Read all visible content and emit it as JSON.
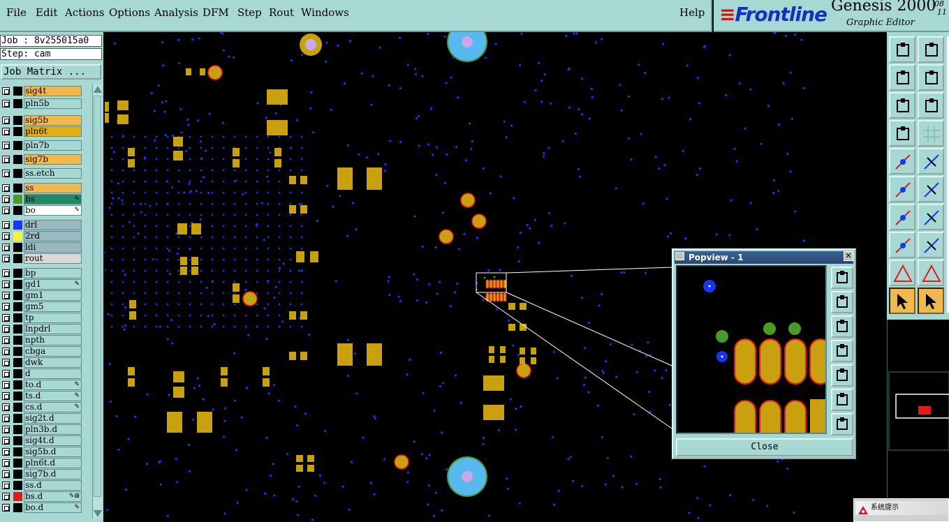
{
  "menubar": {
    "items": [
      "File",
      "Edit",
      "Actions",
      "Options",
      "Analysis",
      "DFM",
      "Step",
      "Rout",
      "Windows"
    ],
    "help": "Help"
  },
  "brand": {
    "logo": "Frontline",
    "product": "Genesis 2000",
    "subtitle": "Graphic Editor",
    "version_top": "08",
    "version_bottom": "11"
  },
  "job": {
    "job_line": "Job : 8v255015a0",
    "step_line": "Step: cam",
    "matrix_button": "Job Matrix ..."
  },
  "layers": [
    {
      "name": "sig4t",
      "bg": "#f0b850",
      "swatch": "#000000",
      "edit": ""
    },
    {
      "name": "pln5b",
      "bg": "#a8d8d4",
      "swatch": "#000000",
      "edit": ""
    },
    {
      "name": "sig5b",
      "bg": "#f0b850",
      "swatch": "#000000",
      "edit": ""
    },
    {
      "name": "pln6t",
      "bg": "#e0b018",
      "swatch": "#000000",
      "edit": ""
    },
    {
      "name": "pln7b",
      "bg": "#a8d8d4",
      "swatch": "#000000",
      "edit": ""
    },
    {
      "name": "sig7b",
      "bg": "#f0b850",
      "swatch": "#000000",
      "edit": ""
    },
    {
      "name": "ss.etch",
      "bg": "#a8d8d4",
      "swatch": "#000000",
      "edit": ""
    },
    {
      "name": "ss",
      "bg": "#f0b850",
      "swatch": "#000000",
      "edit": ""
    },
    {
      "name": "bs",
      "bg": "#1f8a60",
      "swatch": "#4a9a28",
      "edit": "✎"
    },
    {
      "name": "bo",
      "bg": "#ffffff",
      "swatch": "#000000",
      "edit": "✎"
    },
    {
      "name": "drl",
      "bg": "#9ab8c0",
      "swatch": "#1838f0",
      "edit": ""
    },
    {
      "name": "2rd",
      "bg": "#9ab8c0",
      "swatch": "#f8f040",
      "edit": ""
    },
    {
      "name": "ldi",
      "bg": "#9ab8c0",
      "swatch": "#000000",
      "edit": ""
    },
    {
      "name": "rout",
      "bg": "#d8d8d8",
      "swatch": "#000000",
      "edit": ""
    },
    {
      "name": "bp",
      "bg": "#a8d8d4",
      "swatch": "#000000",
      "edit": ""
    },
    {
      "name": "gd1",
      "bg": "#a8d8d4",
      "swatch": "#000000",
      "edit": "✎"
    },
    {
      "name": "gm1",
      "bg": "#a8d8d4",
      "swatch": "#000000",
      "edit": ""
    },
    {
      "name": "gm5",
      "bg": "#a8d8d4",
      "swatch": "#000000",
      "edit": ""
    },
    {
      "name": "tp",
      "bg": "#a8d8d4",
      "swatch": "#000000",
      "edit": ""
    },
    {
      "name": "lnpdrl",
      "bg": "#a8d8d4",
      "swatch": "#000000",
      "edit": ""
    },
    {
      "name": "npth",
      "bg": "#a8d8d4",
      "swatch": "#000000",
      "edit": ""
    },
    {
      "name": "cbga",
      "bg": "#a8d8d4",
      "swatch": "#000000",
      "edit": ""
    },
    {
      "name": "dwk",
      "bg": "#a8d8d4",
      "swatch": "#000000",
      "edit": ""
    },
    {
      "name": "d",
      "bg": "#a8d8d4",
      "swatch": "#000000",
      "edit": ""
    },
    {
      "name": "to.d",
      "bg": "#a8d8d4",
      "swatch": "#000000",
      "edit": "✎"
    },
    {
      "name": "ts.d",
      "bg": "#a8d8d4",
      "swatch": "#000000",
      "edit": "✎"
    },
    {
      "name": "cs.d",
      "bg": "#a8d8d4",
      "swatch": "#000000",
      "edit": "✎"
    },
    {
      "name": "sig2t.d",
      "bg": "#a8d8d4",
      "swatch": "#000000",
      "edit": ""
    },
    {
      "name": "pln3b.d",
      "bg": "#a8d8d4",
      "swatch": "#000000",
      "edit": ""
    },
    {
      "name": "sig4t.d",
      "bg": "#a8d8d4",
      "swatch": "#000000",
      "edit": ""
    },
    {
      "name": "sig5b.d",
      "bg": "#a8d8d4",
      "swatch": "#000000",
      "edit": ""
    },
    {
      "name": "pln6t.d",
      "bg": "#a8d8d4",
      "swatch": "#000000",
      "edit": ""
    },
    {
      "name": "sig7b.d",
      "bg": "#a8d8d4",
      "swatch": "#000000",
      "edit": ""
    },
    {
      "name": "ss.d",
      "bg": "#a8d8d4",
      "swatch": "#000000",
      "edit": ""
    },
    {
      "name": "bs.d",
      "bg": "#a8d8d4",
      "swatch": "#e81818",
      "edit": "✎⊞"
    },
    {
      "name": "bo.d",
      "bg": "#a8d8d4",
      "swatch": "#000000",
      "edit": "✎"
    }
  ],
  "popview": {
    "title": "Popview - 1",
    "close_label": "Close"
  },
  "sysdialog": {
    "title": "系统提示"
  },
  "colors": {
    "panel": "#a8d8d4",
    "pad": "#c8a010",
    "via": "#1838f0",
    "outline": "#e81818",
    "green_pad": "#4a9a28"
  }
}
